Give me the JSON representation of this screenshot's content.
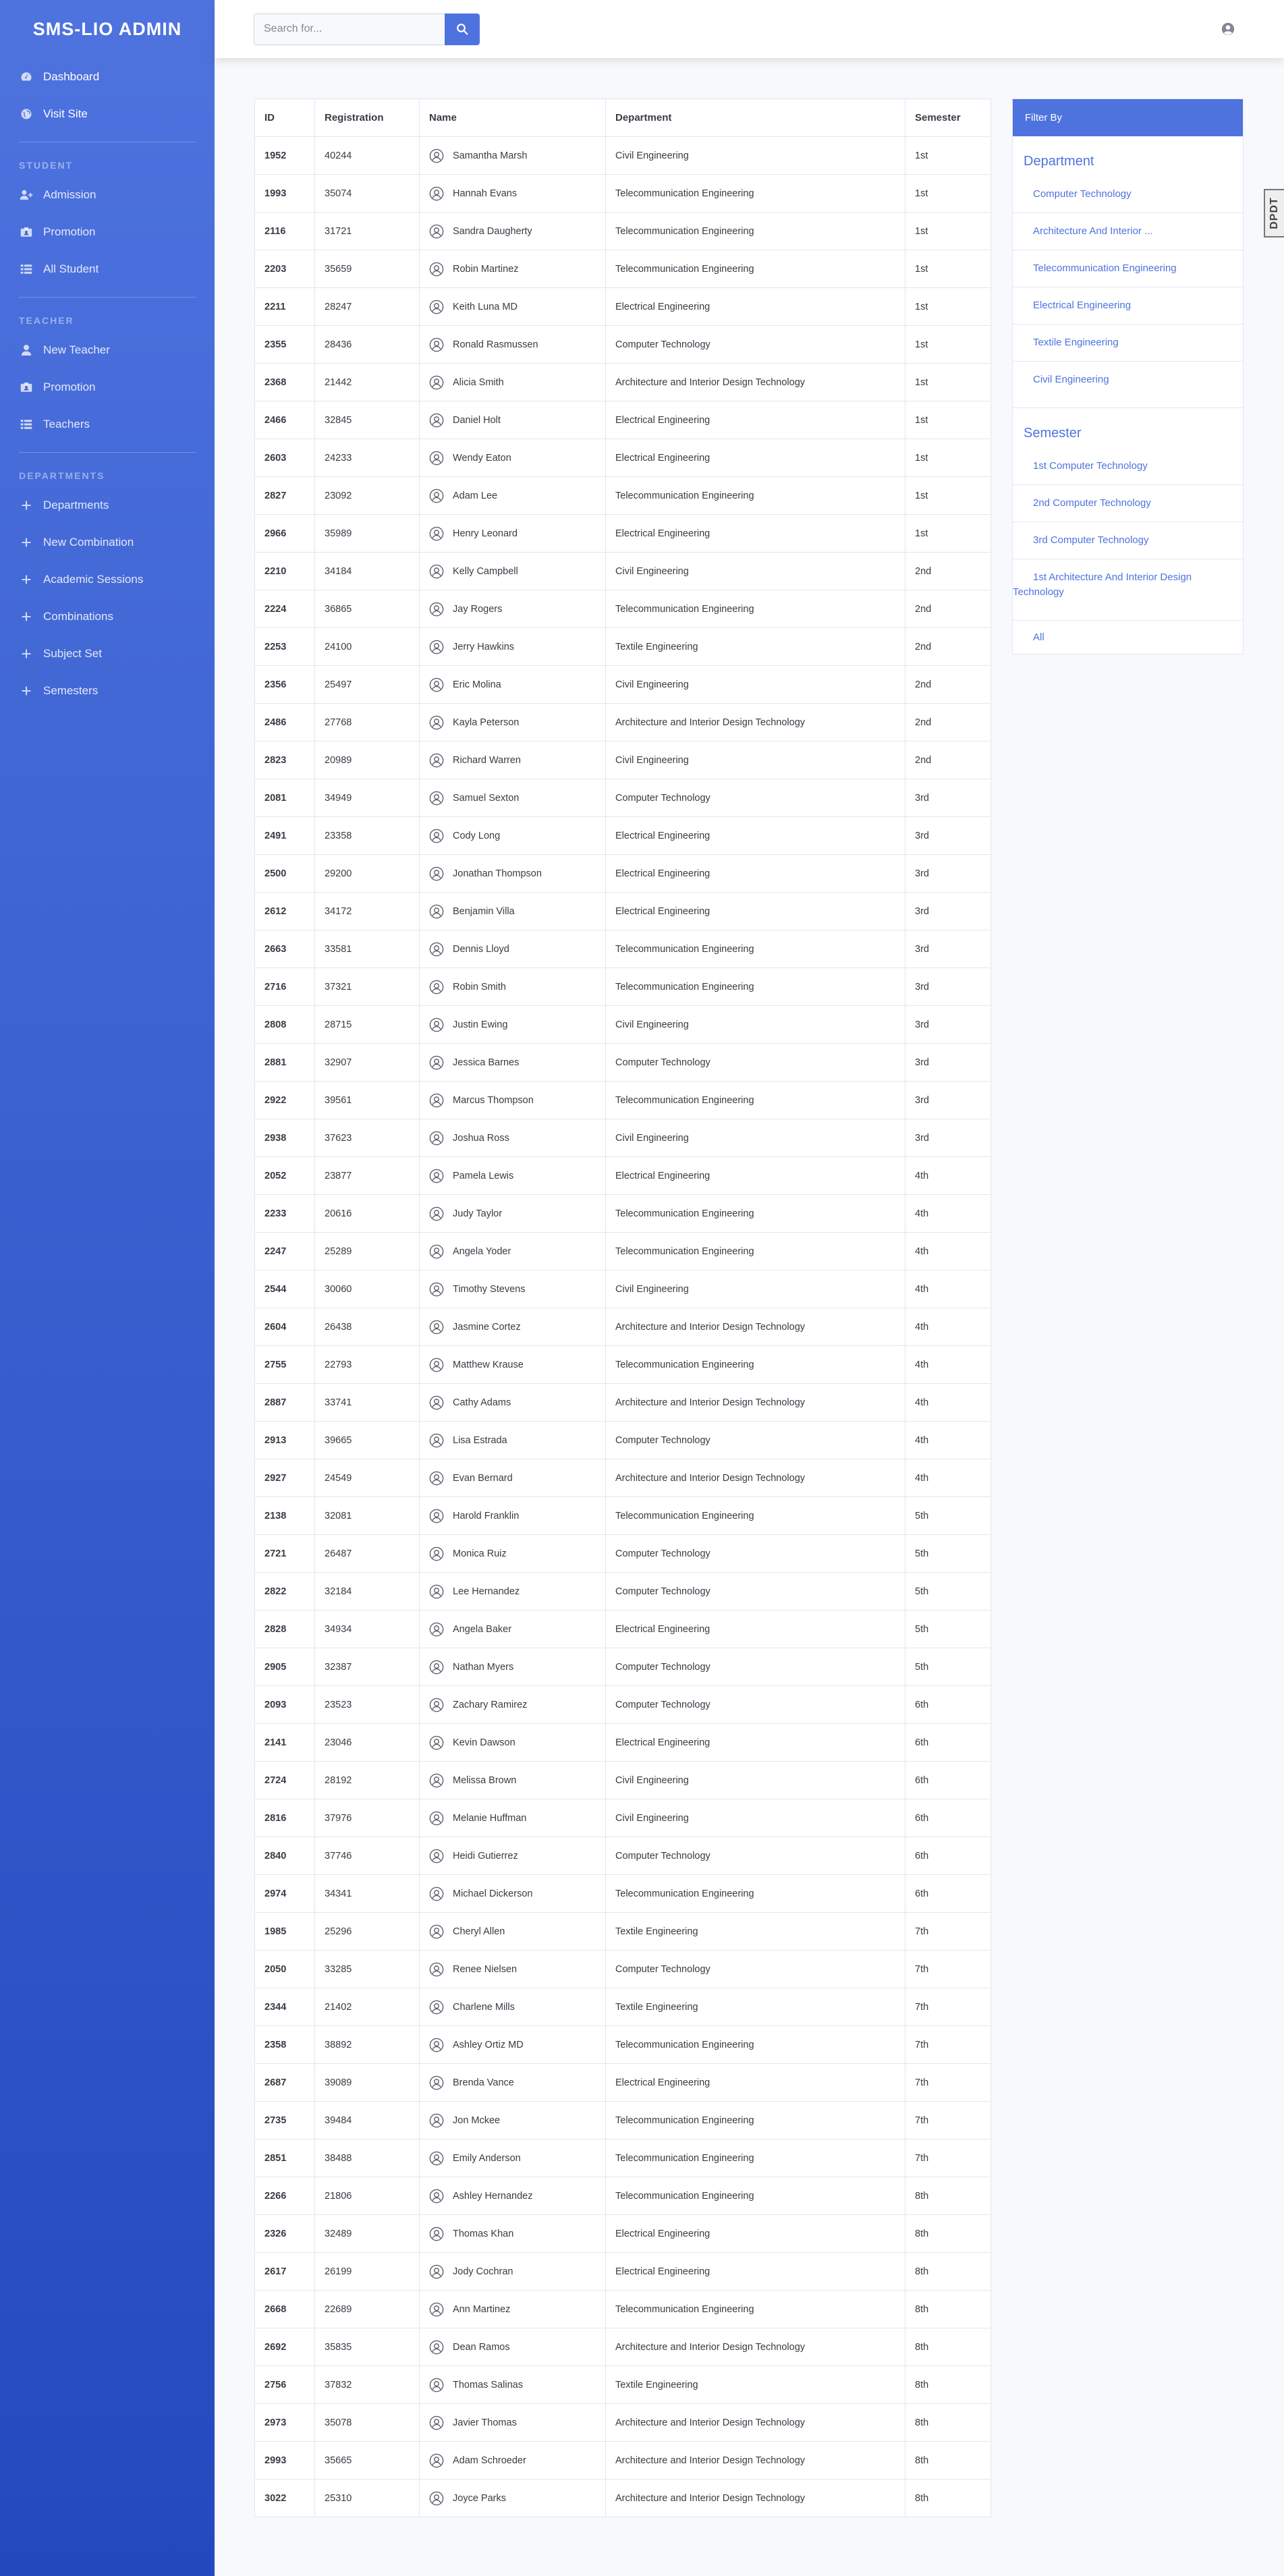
{
  "brand": "SMS-LIO ADMIN",
  "sidebar": {
    "top": [
      {
        "label": "Dashboard",
        "icon": "dashboard-icon"
      },
      {
        "label": "Visit Site",
        "icon": "globe-icon"
      }
    ],
    "student_heading": "STUDENT",
    "student": [
      {
        "label": "Admission",
        "icon": "user-plus-icon"
      },
      {
        "label": "Promotion",
        "icon": "id-card-icon"
      },
      {
        "label": "All Student",
        "icon": "list-icon"
      }
    ],
    "teacher_heading": "TEACHER",
    "teacher": [
      {
        "label": "New Teacher",
        "icon": "user-icon"
      },
      {
        "label": "Promotion",
        "icon": "id-card-icon"
      },
      {
        "label": "Teachers",
        "icon": "list-icon"
      }
    ],
    "departments_heading": "DEPARTMENTS",
    "departments": [
      {
        "label": "Departments",
        "icon": "plus-icon"
      },
      {
        "label": "New Combination",
        "icon": "plus-icon"
      },
      {
        "label": "Academic Sessions",
        "icon": "plus-icon"
      },
      {
        "label": "Combinations",
        "icon": "plus-icon"
      },
      {
        "label": "Subject Set",
        "icon": "plus-icon"
      },
      {
        "label": "Semesters",
        "icon": "plus-icon"
      }
    ]
  },
  "search": {
    "placeholder": "Search for..."
  },
  "dpt_tab": "DPDT",
  "table": {
    "headers": [
      "ID",
      "Registration",
      "Name",
      "Department",
      "Semester"
    ],
    "rows": [
      [
        "1952",
        "40244",
        "Samantha Marsh",
        "Civil Engineering",
        "1st"
      ],
      [
        "1993",
        "35074",
        "Hannah Evans",
        "Telecommunication Engineering",
        "1st"
      ],
      [
        "2116",
        "31721",
        "Sandra Daugherty",
        "Telecommunication Engineering",
        "1st"
      ],
      [
        "2203",
        "35659",
        "Robin Martinez",
        "Telecommunication Engineering",
        "1st"
      ],
      [
        "2211",
        "28247",
        "Keith Luna MD",
        "Electrical Engineering",
        "1st"
      ],
      [
        "2355",
        "28436",
        "Ronald Rasmussen",
        "Computer Technology",
        "1st"
      ],
      [
        "2368",
        "21442",
        "Alicia Smith",
        "Architecture and Interior Design Technology",
        "1st"
      ],
      [
        "2466",
        "32845",
        "Daniel Holt",
        "Electrical Engineering",
        "1st"
      ],
      [
        "2603",
        "24233",
        "Wendy Eaton",
        "Electrical Engineering",
        "1st"
      ],
      [
        "2827",
        "23092",
        "Adam Lee",
        "Telecommunication Engineering",
        "1st"
      ],
      [
        "2966",
        "35989",
        "Henry Leonard",
        "Electrical Engineering",
        "1st"
      ],
      [
        "2210",
        "34184",
        "Kelly Campbell",
        "Civil Engineering",
        "2nd"
      ],
      [
        "2224",
        "36865",
        "Jay Rogers",
        "Telecommunication Engineering",
        "2nd"
      ],
      [
        "2253",
        "24100",
        "Jerry Hawkins",
        "Textile Engineering",
        "2nd"
      ],
      [
        "2356",
        "25497",
        "Eric Molina",
        "Civil Engineering",
        "2nd"
      ],
      [
        "2486",
        "27768",
        "Kayla Peterson",
        "Architecture and Interior Design Technology",
        "2nd"
      ],
      [
        "2823",
        "20989",
        "Richard Warren",
        "Civil Engineering",
        "2nd"
      ],
      [
        "2081",
        "34949",
        "Samuel Sexton",
        "Computer Technology",
        "3rd"
      ],
      [
        "2491",
        "23358",
        "Cody Long",
        "Electrical Engineering",
        "3rd"
      ],
      [
        "2500",
        "29200",
        "Jonathan Thompson",
        "Electrical Engineering",
        "3rd"
      ],
      [
        "2612",
        "34172",
        "Benjamin Villa",
        "Electrical Engineering",
        "3rd"
      ],
      [
        "2663",
        "33581",
        "Dennis Lloyd",
        "Telecommunication Engineering",
        "3rd"
      ],
      [
        "2716",
        "37321",
        "Robin Smith",
        "Telecommunication Engineering",
        "3rd"
      ],
      [
        "2808",
        "28715",
        "Justin Ewing",
        "Civil Engineering",
        "3rd"
      ],
      [
        "2881",
        "32907",
        "Jessica Barnes",
        "Computer Technology",
        "3rd"
      ],
      [
        "2922",
        "39561",
        "Marcus Thompson",
        "Telecommunication Engineering",
        "3rd"
      ],
      [
        "2938",
        "37623",
        "Joshua Ross",
        "Civil Engineering",
        "3rd"
      ],
      [
        "2052",
        "23877",
        "Pamela Lewis",
        "Electrical Engineering",
        "4th"
      ],
      [
        "2233",
        "20616",
        "Judy Taylor",
        "Telecommunication Engineering",
        "4th"
      ],
      [
        "2247",
        "25289",
        "Angela Yoder",
        "Telecommunication Engineering",
        "4th"
      ],
      [
        "2544",
        "30060",
        "Timothy Stevens",
        "Civil Engineering",
        "4th"
      ],
      [
        "2604",
        "26438",
        "Jasmine Cortez",
        "Architecture and Interior Design Technology",
        "4th"
      ],
      [
        "2755",
        "22793",
        "Matthew Krause",
        "Telecommunication Engineering",
        "4th"
      ],
      [
        "2887",
        "33741",
        "Cathy Adams",
        "Architecture and Interior Design Technology",
        "4th"
      ],
      [
        "2913",
        "39665",
        "Lisa Estrada",
        "Computer Technology",
        "4th"
      ],
      [
        "2927",
        "24549",
        "Evan Bernard",
        "Architecture and Interior Design Technology",
        "4th"
      ],
      [
        "2138",
        "32081",
        "Harold Franklin",
        "Telecommunication Engineering",
        "5th"
      ],
      [
        "2721",
        "26487",
        "Monica Ruiz",
        "Computer Technology",
        "5th"
      ],
      [
        "2822",
        "32184",
        "Lee Hernandez",
        "Computer Technology",
        "5th"
      ],
      [
        "2828",
        "34934",
        "Angela Baker",
        "Electrical Engineering",
        "5th"
      ],
      [
        "2905",
        "32387",
        "Nathan Myers",
        "Computer Technology",
        "5th"
      ],
      [
        "2093",
        "23523",
        "Zachary Ramirez",
        "Computer Technology",
        "6th"
      ],
      [
        "2141",
        "23046",
        "Kevin Dawson",
        "Electrical Engineering",
        "6th"
      ],
      [
        "2724",
        "28192",
        "Melissa Brown",
        "Civil Engineering",
        "6th"
      ],
      [
        "2816",
        "37976",
        "Melanie Huffman",
        "Civil Engineering",
        "6th"
      ],
      [
        "2840",
        "37746",
        "Heidi Gutierrez",
        "Computer Technology",
        "6th"
      ],
      [
        "2974",
        "34341",
        "Michael Dickerson",
        "Telecommunication Engineering",
        "6th"
      ],
      [
        "1985",
        "25296",
        "Cheryl Allen",
        "Textile Engineering",
        "7th"
      ],
      [
        "2050",
        "33285",
        "Renee Nielsen",
        "Computer Technology",
        "7th"
      ],
      [
        "2344",
        "21402",
        "Charlene Mills",
        "Textile Engineering",
        "7th"
      ],
      [
        "2358",
        "38892",
        "Ashley Ortiz MD",
        "Telecommunication Engineering",
        "7th"
      ],
      [
        "2687",
        "39089",
        "Brenda Vance",
        "Electrical Engineering",
        "7th"
      ],
      [
        "2735",
        "39484",
        "Jon Mckee",
        "Telecommunication Engineering",
        "7th"
      ],
      [
        "2851",
        "38488",
        "Emily Anderson",
        "Telecommunication Engineering",
        "7th"
      ],
      [
        "2266",
        "21806",
        "Ashley Hernandez",
        "Telecommunication Engineering",
        "8th"
      ],
      [
        "2326",
        "32489",
        "Thomas Khan",
        "Electrical Engineering",
        "8th"
      ],
      [
        "2617",
        "26199",
        "Jody Cochran",
        "Electrical Engineering",
        "8th"
      ],
      [
        "2668",
        "22689",
        "Ann Martinez",
        "Telecommunication Engineering",
        "8th"
      ],
      [
        "2692",
        "35835",
        "Dean Ramos",
        "Architecture and Interior Design Technology",
        "8th"
      ],
      [
        "2756",
        "37832",
        "Thomas Salinas",
        "Textile Engineering",
        "8th"
      ],
      [
        "2973",
        "35078",
        "Javier Thomas",
        "Architecture and Interior Design Technology",
        "8th"
      ],
      [
        "2993",
        "35665",
        "Adam Schroeder",
        "Architecture and Interior Design Technology",
        "8th"
      ],
      [
        "3022",
        "25310",
        "Joyce Parks",
        "Architecture and Interior Design Technology",
        "8th"
      ]
    ]
  },
  "filter": {
    "header": "Filter By",
    "department_title": "Department",
    "departments": [
      "Computer Technology",
      "Architecture And Interior ...",
      "Telecommunication Engineering",
      "Electrical Engineering",
      "Textile Engineering",
      "Civil Engineering"
    ],
    "semester_title": "Semester",
    "semesters": [
      "1st Computer Technology",
      "2nd Computer Technology",
      "3rd Computer Technology",
      "1st Architecture And Interior Design Technology"
    ],
    "all_label": "All"
  },
  "colors": {
    "primary": "#4e73df",
    "sidebar_end": "#224abe",
    "background": "#f8f9fc"
  }
}
